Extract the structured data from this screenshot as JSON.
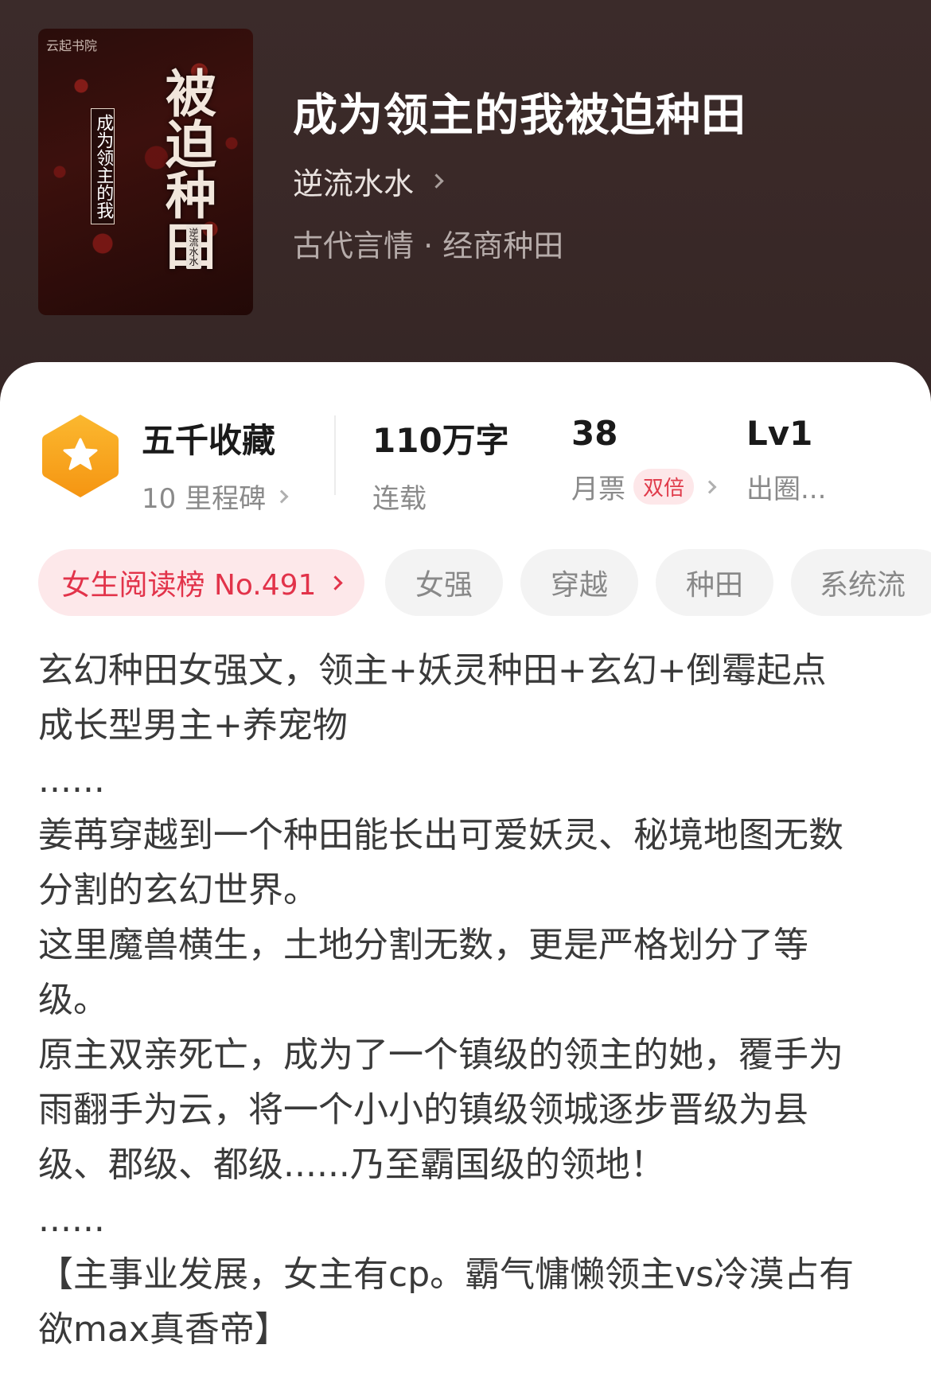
{
  "book": {
    "title": "成为领主的我被迫种田",
    "author": "逆流水水",
    "genre": "古代言情 · 经商种田",
    "cover": {
      "publisher": "云起书院",
      "title_main": "被迫种田",
      "title_sub": "成为领主的我",
      "author": "逆流水水"
    }
  },
  "stats": {
    "collection": {
      "title": "五千收藏",
      "sub": "10 里程碑"
    },
    "words": {
      "value": "110万字",
      "status": "连载"
    },
    "votes": {
      "value": "38",
      "label": "月票",
      "badge": "双倍"
    },
    "level": {
      "value": "Lv1",
      "label": "出圈..."
    }
  },
  "tags": {
    "rank": "女生阅读榜 No.491",
    "items": [
      "女强",
      "穿越",
      "种田",
      "系统流"
    ]
  },
  "description": [
    "玄幻种田女强文，领主+妖灵种田+玄幻+倒霉起点\n成长型男主+养宠物",
    "......",
    "姜苒穿越到一个种田能长出可爱妖灵、秘境地图无数\n分割的玄幻世界。",
    "这里魔兽横生，土地分割无数，更是严格划分了等\n级。",
    "原主双亲死亡，成为了一个镇级的领主的她，覆手为\n雨翻手为云，将一个小小的镇级领城逐步晋级为县\n级、郡级、都级......乃至霸国级的领地！",
    "......",
    "【主事业发展，女主有cp。霸气慵懒领主vs冷漠占有\n欲max真香帝】"
  ],
  "colors": {
    "header_bg": "#3a2928",
    "accent_red": "#e2334a",
    "badge_orange": "#f7a21b"
  }
}
